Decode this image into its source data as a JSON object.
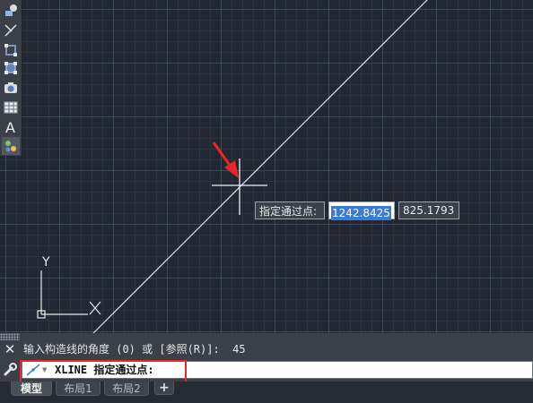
{
  "dynamic_input": {
    "label": "指定通过点:",
    "x_value": "1242.8425",
    "y_value": "825.1793"
  },
  "ucs": {
    "y_axis_label": "Y"
  },
  "command": {
    "history_line": "输入构造线的角度 (0) 或 [参照(R)]:  45",
    "current_prompt": "XLINE 指定通过点:"
  },
  "tabs": [
    {
      "label": "模型",
      "active": true
    },
    {
      "label": "布局1",
      "active": false
    },
    {
      "label": "布局2",
      "active": false
    }
  ],
  "tab_add_label": "+",
  "icons": {
    "toolbar": [
      "shapes-icon",
      "line-icon",
      "rectangle-icon",
      "rectangle-select-icon",
      "camera-icon",
      "table-icon",
      "text-icon",
      "blocks-icon"
    ],
    "annotation": "red-arrow-icon",
    "close": "close-icon",
    "customize": "wrench-icon",
    "command": "xline-icon"
  },
  "colors": {
    "canvas": "#222833",
    "xline": "#e0e0e0",
    "arrow": "#e8262a",
    "highlight": "#e8262a",
    "selection": "#3b7bd4"
  }
}
